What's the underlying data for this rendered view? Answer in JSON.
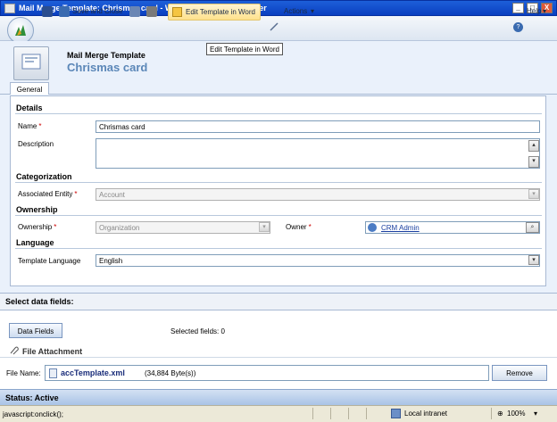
{
  "window": {
    "title": "Mail Merge Template: Chrismas card - Windows Internet Explorer",
    "buttons": [
      "_",
      "□",
      "X"
    ]
  },
  "toolbar": {
    "save_close": "Save and Close",
    "edit_template": "Edit Template in Word",
    "actions": "Actions",
    "help": "Help"
  },
  "tooltip": "Edit Template in Word",
  "header": {
    "entity": "Mail Merge Template",
    "name": "Chrismas card"
  },
  "tabs": [
    {
      "label": "General"
    }
  ],
  "form": {
    "details": {
      "heading": "Details",
      "name_label": "Name",
      "name_value": "Chrismas card",
      "description_label": "Description",
      "description_value": ""
    },
    "categorization": {
      "heading": "Categorization",
      "entity_label": "Associated Entity",
      "entity_value": "Account"
    },
    "ownership": {
      "heading": "Ownership",
      "ownership_label": "Ownership",
      "ownership_value": "Organization",
      "owner_label": "Owner",
      "owner_value": "CRM Admin"
    },
    "language": {
      "heading": "Language",
      "template_language_label": "Template Language",
      "template_language_value": "English"
    },
    "required_marker": "*"
  },
  "data_fields": {
    "heading": "Select data fields:",
    "button": "Data Fields",
    "selected_text": "Selected fields: 0"
  },
  "attachment": {
    "heading": "File Attachment",
    "file_label": "File Name:",
    "file_name": "accTemplate.xml",
    "file_size": "(34,884 Byte(s))",
    "remove_button": "Remove"
  },
  "status": {
    "text": "Status: Active"
  },
  "ie_status": {
    "left_text": "javascript:onclick();",
    "zone": "Local intranet",
    "zoom": "100%"
  },
  "colors": {
    "accent_blue": "#5b87b8",
    "required_red": "#cc0000",
    "titlebar": "#0a3fc0"
  }
}
